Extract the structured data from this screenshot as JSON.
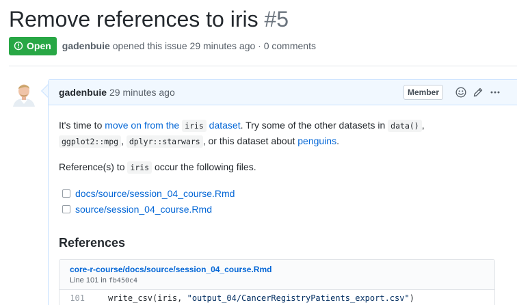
{
  "issue": {
    "title": "Remove references to iris",
    "number": "#5",
    "state": "Open",
    "author": "gadenbuie",
    "opened_text": "opened this issue 29 minutes ago · 0 comments"
  },
  "comment": {
    "author": "gadenbuie",
    "time": "29 minutes ago",
    "role": "Member",
    "body": {
      "p1_intro": "It's time to",
      "p1_link1": "move on from the",
      "p1_code_iris": "iris",
      "p1_link2": "dataset",
      "p1_text2": ". Try some of the other datasets in",
      "p1_code_data": "data()",
      "p1_comma": ",",
      "p1_code_mpg": "ggplot2::mpg",
      "p1_code_starwars": "dplyr::starwars",
      "p1_text3": ", or this dataset about",
      "p1_link3": "penguins",
      "p1_period": ".",
      "p2_start": "Reference(s) to",
      "p2_code": "iris",
      "p2_end": "occur the following files.",
      "tasks": [
        {
          "label": "docs/source/session_04_course.Rmd"
        },
        {
          "label": "source/session_04_course.Rmd"
        }
      ],
      "references_heading": "References",
      "reference": {
        "path": "core-r-course/docs/source/session_04_course.Rmd",
        "line_prefix": "Line 101 in",
        "commit": "fb450c4",
        "line_number": "101",
        "code_before": "write_csv(iris, ",
        "code_string": "\"output_04/CancerRegistryPatients_export.csv\"",
        "code_after": ")"
      }
    }
  },
  "colors": {
    "open_green": "#28a745",
    "link_blue": "#0366d6",
    "header_bg": "#f1f8ff",
    "header_border": "#c8e1ff"
  },
  "icons": [
    "issue-opened-icon",
    "smiley-icon",
    "pencil-icon",
    "kebab-horizontal-icon"
  ]
}
